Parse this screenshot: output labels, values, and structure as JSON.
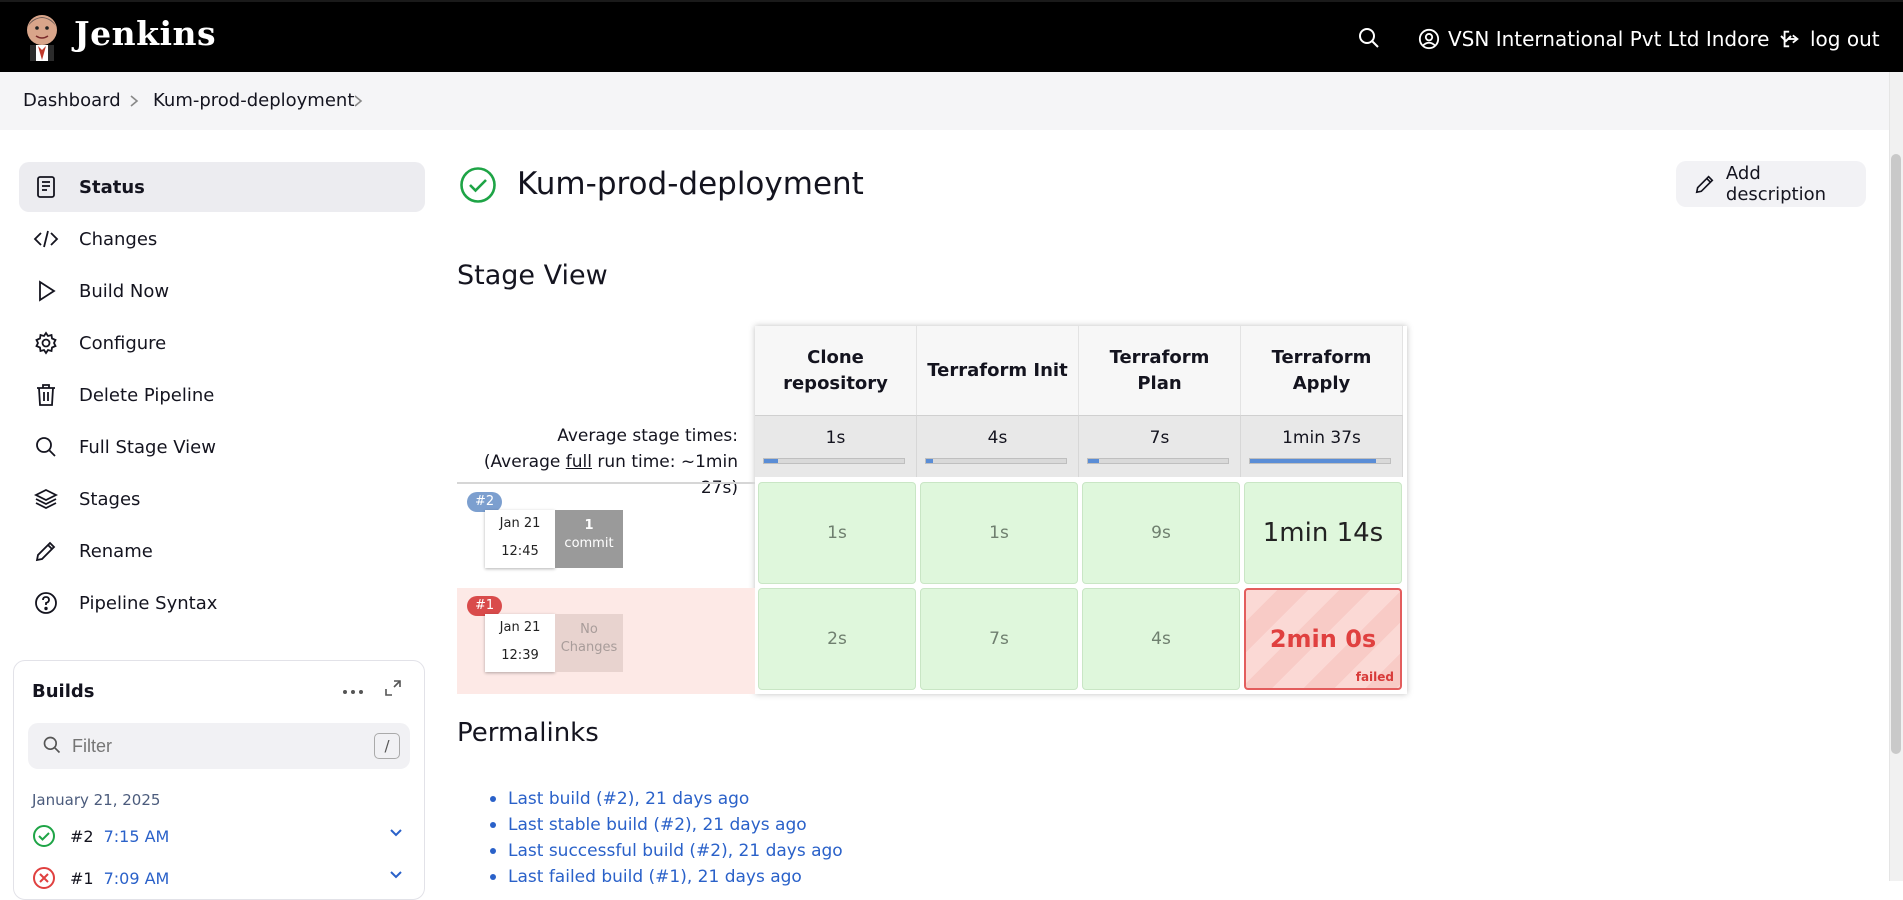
{
  "header": {
    "brand": "Jenkins",
    "user_name": "VSN International Pvt Ltd Indore",
    "logout_label": "log out"
  },
  "breadcrumb": [
    "Dashboard",
    "Kum-prod-deployment"
  ],
  "sidebar": {
    "items": [
      {
        "label": "Status",
        "icon": "status-doc-icon"
      },
      {
        "label": "Changes",
        "icon": "code-icon"
      },
      {
        "label": "Build Now",
        "icon": "play-icon"
      },
      {
        "label": "Configure",
        "icon": "gear-icon"
      },
      {
        "label": "Delete Pipeline",
        "icon": "trash-icon"
      },
      {
        "label": "Full Stage View",
        "icon": "search-icon"
      },
      {
        "label": "Stages",
        "icon": "layers-icon"
      },
      {
        "label": "Rename",
        "icon": "pencil-icon"
      },
      {
        "label": "Pipeline Syntax",
        "icon": "help-icon"
      }
    ]
  },
  "builds": {
    "title": "Builds",
    "filter_placeholder": "Filter",
    "filter_shortcut": "/",
    "date_group": "January 21, 2025",
    "rows": [
      {
        "num": "#2",
        "time": "7:15 AM",
        "status": "success"
      },
      {
        "num": "#1",
        "time": "7:09 AM",
        "status": "failed"
      }
    ]
  },
  "main": {
    "title": "Kum-prod-deployment",
    "add_description": "Add description",
    "stage_view_title": "Stage View",
    "avg_label": "Average stage times:",
    "avg_full_prefix": "(Average ",
    "avg_full_word": "full",
    "avg_full_suffix": " run time: ~1min 27s)",
    "permalinks_title": "Permalinks",
    "permalinks": [
      "Last build (#2), 21 days ago",
      "Last stable build (#2), 21 days ago",
      "Last successful build (#2), 21 days ago",
      "Last failed build (#1), 21 days ago"
    ]
  },
  "stage_view": {
    "stages": [
      {
        "name": "Clone repository",
        "avg": "1s",
        "avg_fraction": 0.1
      },
      {
        "name": "Terraform Init",
        "avg": "4s",
        "avg_fraction": 0.05
      },
      {
        "name": "Terraform Plan",
        "avg": "7s",
        "avg_fraction": 0.08
      },
      {
        "name": "Terraform Apply",
        "avg": "1min 37s",
        "avg_fraction": 0.9
      }
    ],
    "runs": [
      {
        "badge": "#2",
        "date": "Jan 21",
        "time": "12:45",
        "changes_line1": "1",
        "changes_line2": "commit",
        "status": "success",
        "durations": [
          "1s",
          "1s",
          "9s",
          "1min 14s"
        ]
      },
      {
        "badge": "#1",
        "date": "Jan 21",
        "time": "12:39",
        "changes_line1": "No",
        "changes_line2": "Changes",
        "status": "failed",
        "durations": [
          "2s",
          "7s",
          "4s",
          "2min 0s"
        ],
        "failed_label": "failed"
      }
    ]
  },
  "colors": {
    "accent_blue": "#2a61c9",
    "success_green": "#1ea446",
    "failed_red": "#e0403f",
    "badge_blue": "#7c9fcf",
    "badge_red": "#d94b4b"
  }
}
